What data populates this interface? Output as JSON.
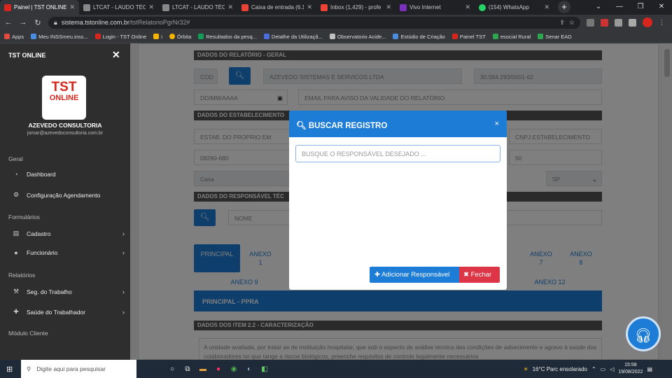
{
  "browser": {
    "tabs": [
      {
        "title": "Painel | TST ONLINE",
        "color": "#d7261e",
        "active": true
      },
      {
        "title": "LTCAT - LAUDO TÉCNI",
        "color": "#888888",
        "active": false
      },
      {
        "title": "LTCAT - LAUDO TÉCNI",
        "color": "#888888",
        "active": false
      },
      {
        "title": "Caixa de entrada (6.1",
        "color": "#ea4335",
        "active": false
      },
      {
        "title": "Inbox (1,429) - profe",
        "color": "#ea4335",
        "active": false
      },
      {
        "title": "Vivo Internet",
        "color": "#7b2fbf",
        "active": false
      },
      {
        "title": "(154) WhatsApp",
        "color": "#25d366",
        "active": false
      }
    ],
    "new_tab": "+",
    "url_host": "sistema.tstonline.com.br",
    "url_path": "/tstRelatorioPgrNr32#",
    "bookmarks": [
      {
        "label": "Apps",
        "color": "#e04a3f"
      },
      {
        "label": "Meu INSSmeu.inss...",
        "color": "#4a8de0"
      },
      {
        "label": "Login - TST Online",
        "color": "#d7261e"
      },
      {
        "label": "i",
        "color": "#f4b400"
      },
      {
        "label": "Órbita",
        "color": "#f4b400"
      },
      {
        "label": "Resultados da pesq...",
        "color": "#0f9d58"
      },
      {
        "label": "Detalhe da Utilizaçã...",
        "color": "#4a6de0"
      },
      {
        "label": "Observatorio Acide...",
        "color": "#c0c0c0"
      },
      {
        "label": "Estúdio de Criação",
        "color": "#4a8de0"
      },
      {
        "label": "Painel TST",
        "color": "#d7261e"
      },
      {
        "label": "esocial Rural",
        "color": "#2da44e"
      },
      {
        "label": "Senar EAD",
        "color": "#2da44e"
      }
    ]
  },
  "sidebar": {
    "title": "TST ONLINE",
    "close": "✕",
    "logo_line1": "TST",
    "logo_line2": "ONLINE",
    "company": "AZEVEDO CONSULTORIA",
    "email": "jomar@azevedoconsultoria.com.br",
    "sections": [
      {
        "label": "Geral"
      },
      {
        "label": "Formulários"
      },
      {
        "label": "Relatórios"
      },
      {
        "label": "Módulo Cliente"
      }
    ],
    "items": [
      {
        "label": "Dashboard",
        "icon": "dashboard-icon"
      },
      {
        "label": "Configuração Agendamento",
        "icon": "gear-icon"
      },
      {
        "label": "Cadastro",
        "icon": "clipboard-icon"
      },
      {
        "label": "Funcionário",
        "icon": "user-icon"
      },
      {
        "label": "Seg. do Trabalho",
        "icon": "gavel-icon"
      },
      {
        "label": "Saúde do Trabalhador",
        "icon": "medical-icon"
      }
    ]
  },
  "form": {
    "sec_geral": "DADOS DO RELATÓRIO - GERAL",
    "cod": "COD",
    "company_name": "AZEVEDO SISTEMAS E SERVICOS LTDA",
    "cnpj": "30.584.293/0001-62",
    "date": "DD/MM/AAAA",
    "email_placeholder": "EMAIL PARA AVISO DA VALIDADE DO RELATÓRIO",
    "sec_estab": "DADOS DO ESTABELECIMENTO",
    "estab": "ESTAB. DO PROPRIO EM",
    "cnpj_estab": "CNPJ ESTABELECIMENTO",
    "cep": "08290-680",
    "number": "50",
    "complement": "Casa",
    "uf": "SP",
    "sec_resp": "DADOS DO RESPONSÁVEL TÉC",
    "nome": "NOME",
    "tabs": [
      "PRINCIPAL",
      "ANEXO 1",
      "ANEXO 7",
      "ANEXO 8",
      "ANEXO 9",
      "ANEXO 12"
    ],
    "ppra": "PRINCIPAL - PPRA",
    "sec_item": "DADOS DOS ITEM 2.2 - CARACTERIZAÇÃO",
    "caracterizacao": "A unidade avaliada, por tratar se de instituição hospitalar, que sob o aspecto de análise técnica das condições de adoecimento e agravo à saúde dos colaboradores no que tange a riscos biológicos, preenche requisitos de controle legalmente necessários"
  },
  "modal": {
    "title": "BUSCAR REGISTRO",
    "close": "×",
    "search_placeholder": "BUSQUE O RESPONSÁVEL DESEJADO ...",
    "add_button": "Adicionar Responsável",
    "close_button": "Fechar"
  },
  "taskbar": {
    "search_placeholder": "Digite aqui para pesquisar",
    "weather": "16°C  Parc ensolarado",
    "time": "15:58",
    "date": "19/08/2022"
  }
}
